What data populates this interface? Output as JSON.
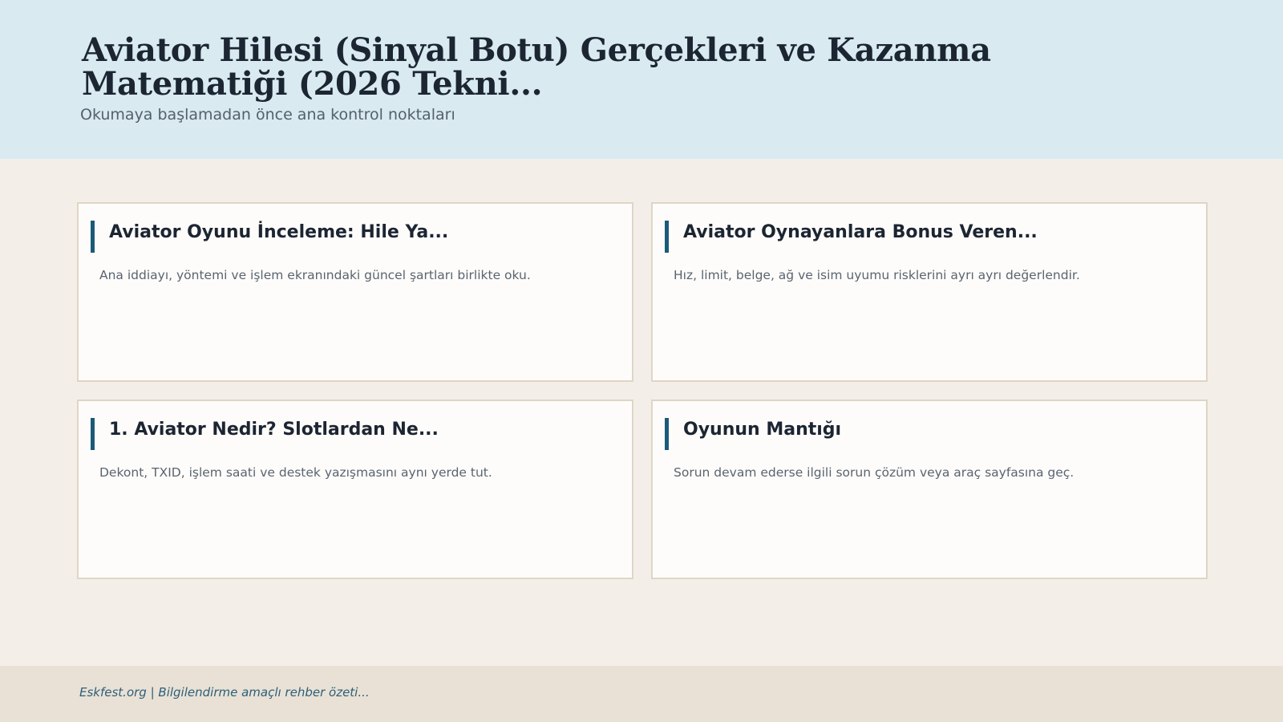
{
  "header": {
    "title": "Aviator Hilesi (Sinyal Botu) Gerçekleri ve Kazanma Matematiği (2026 Tekni...",
    "subtitle": "Okumaya başlamadan önce ana kontrol noktaları"
  },
  "cards": [
    {
      "title": "Aviator Oyunu İnceleme: Hile Ya...",
      "description": "Ana iddiayı, yöntemi ve işlem ekranındaki güncel şartları birlikte oku."
    },
    {
      "title": "Aviator Oynayanlara Bonus Veren...",
      "description": "Hız, limit, belge, ağ ve isim uyumu risklerini ayrı ayrı değerlendir."
    },
    {
      "title": "1. Aviator Nedir? Slotlardan Ne...",
      "description": "Dekont, TXID, işlem saati ve destek yazışmasını aynı yerde tut."
    },
    {
      "title": "Oyunun Mantığı",
      "description": "Sorun devam ederse ilgili sorun çözüm veya araç sayfasına geç."
    }
  ],
  "footer": {
    "text": "Eskfest.org | Bilgilendirme amaçlı rehber özeti..."
  },
  "colors": {
    "header_bg": "#d9eaf1",
    "page_bg": "#f3efe8",
    "accent": "#1a5a78",
    "footer_bg": "#e9e1d5"
  }
}
